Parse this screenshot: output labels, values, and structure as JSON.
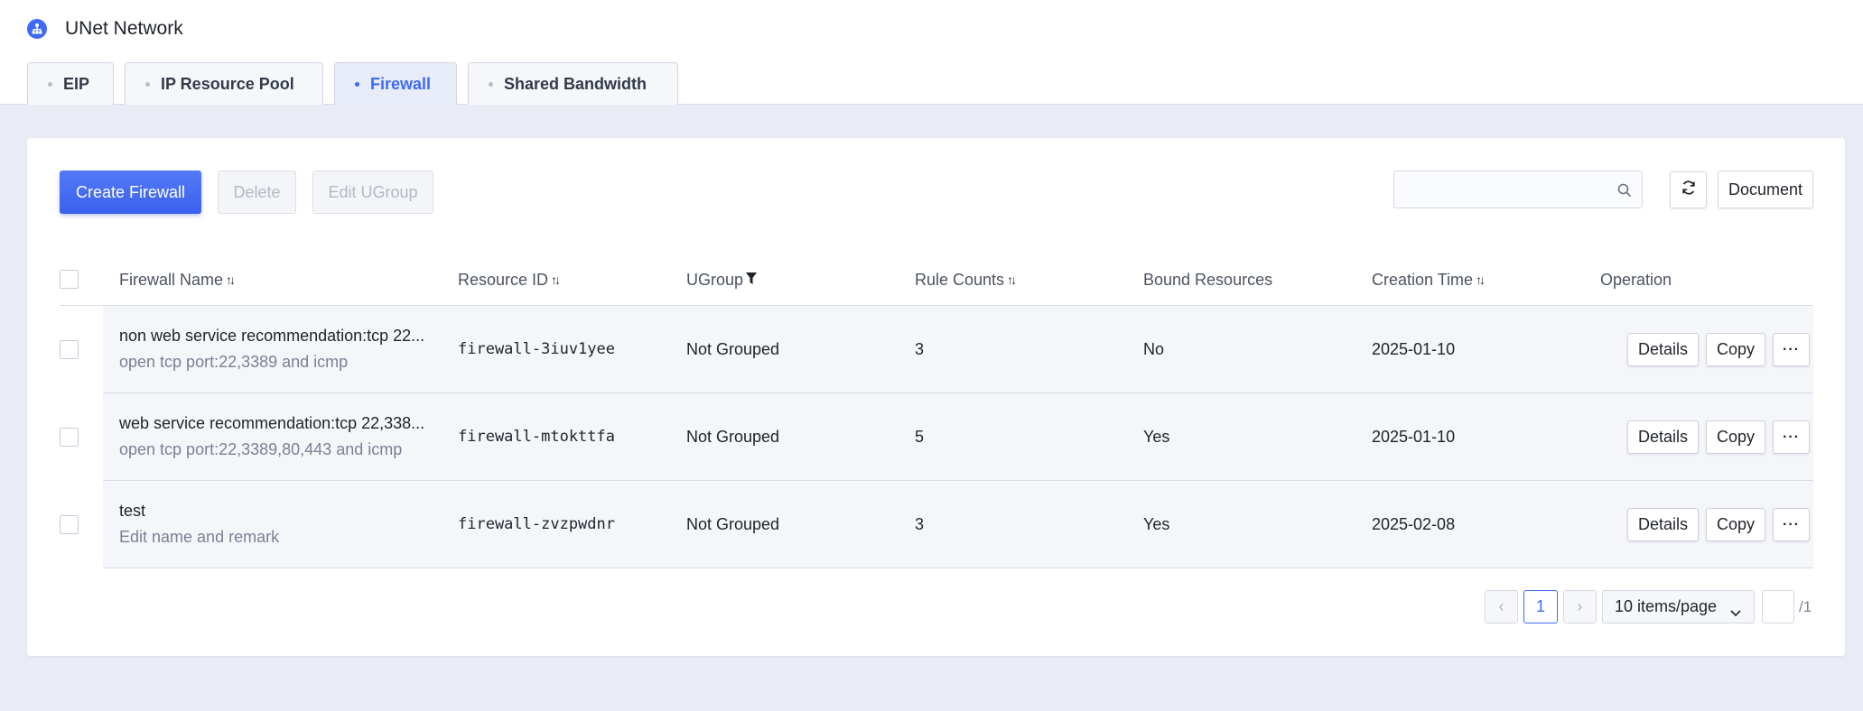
{
  "app": {
    "title": "UNet Network",
    "logo_icon": "network-icon",
    "accent_color": "#3f6af5"
  },
  "tabs": [
    {
      "label": "EIP",
      "active": false
    },
    {
      "label": "IP Resource Pool",
      "active": false
    },
    {
      "label": "Firewall",
      "active": true
    },
    {
      "label": "Shared Bandwidth",
      "active": false
    }
  ],
  "toolbar": {
    "create_label": "Create Firewall",
    "delete_label": "Delete",
    "edit_ugroup_label": "Edit UGroup",
    "search_placeholder": "",
    "search_icon": "search-icon",
    "refresh_icon": "refresh-icon",
    "document_label": "Document"
  },
  "table": {
    "headers": {
      "name": "Firewall Name",
      "resource_id": "Resource ID",
      "ugroup": "UGroup",
      "rule_counts": "Rule Counts",
      "bound": "Bound Resources",
      "created": "Creation Time",
      "operation": "Operation"
    },
    "rows": [
      {
        "name": "non web service recommendation:tcp 22...",
        "remark": "open tcp port:22,3389 and icmp",
        "resource_id": "firewall-3iuv1yee",
        "ugroup": "Not Grouped",
        "rule_counts": "3",
        "bound": "No",
        "created": "2025-01-10"
      },
      {
        "name": "web service recommendation:tcp 22,338...",
        "remark": "open tcp port:22,3389,80,443 and icmp",
        "resource_id": "firewall-mtokttfa",
        "ugroup": "Not Grouped",
        "rule_counts": "5",
        "bound": "Yes",
        "created": "2025-01-10"
      },
      {
        "name": "test",
        "remark": "Edit name and remark",
        "resource_id": "firewall-zvzpwdnr",
        "ugroup": "Not Grouped",
        "rule_counts": "3",
        "bound": "Yes",
        "created": "2025-02-08"
      }
    ],
    "op_labels": {
      "details": "Details",
      "copy": "Copy",
      "more": "···"
    }
  },
  "pagination": {
    "prev": "‹",
    "current_page": "1",
    "next": "›",
    "page_size": "10 items/page",
    "jump_value": "",
    "total_pages": "/1"
  }
}
